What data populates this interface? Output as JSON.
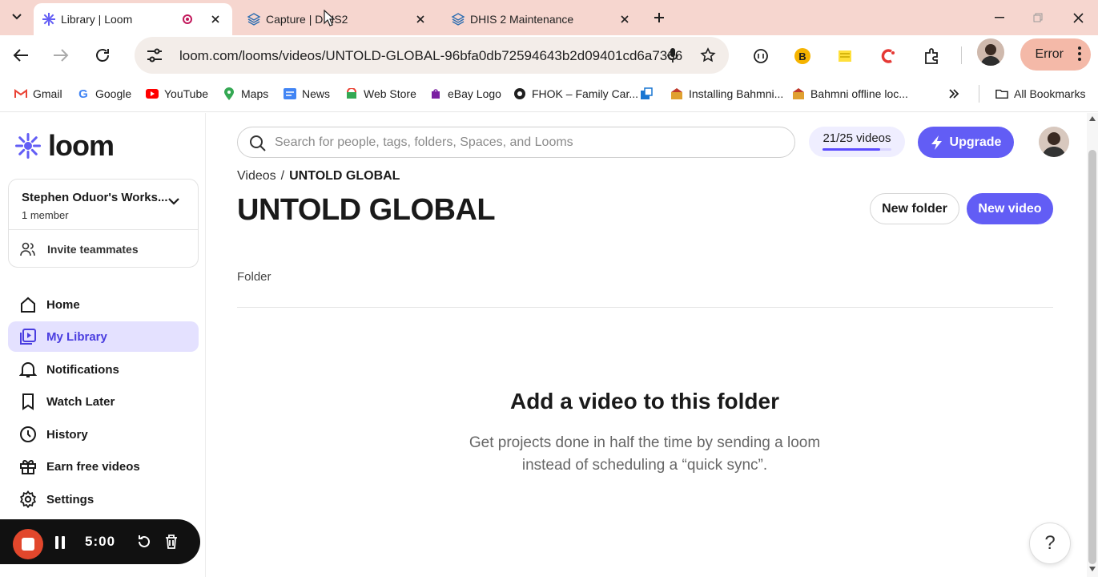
{
  "browser": {
    "tabs": [
      {
        "title": "Library | Loom",
        "active": true,
        "recording": true
      },
      {
        "title": "Capture | DHIS2",
        "active": false
      },
      {
        "title": "DHIS 2 Maintenance",
        "active": false
      }
    ],
    "url": "loom.com/looms/videos/UNTOLD-GLOBAL-96bfa0db72594643b2d09401cd6a7366",
    "error_label": "Error",
    "extension_badge": "B",
    "bookmarks": [
      {
        "label": "Gmail",
        "icon": "gmail-icon"
      },
      {
        "label": "Google",
        "icon": "google-icon"
      },
      {
        "label": "YouTube",
        "icon": "youtube-icon"
      },
      {
        "label": "Maps",
        "icon": "maps-icon"
      },
      {
        "label": "News",
        "icon": "news-icon"
      },
      {
        "label": "Web Store",
        "icon": "webstore-icon"
      },
      {
        "label": "eBay Logo",
        "icon": "ebay-icon"
      },
      {
        "label": "FHOK – Family Car...",
        "icon": "github-icon"
      },
      {
        "label": "",
        "icon": "app-icon"
      },
      {
        "label": "Installing Bahmni...",
        "icon": "bahmni-icon"
      },
      {
        "label": "Bahmni offline loc...",
        "icon": "bahmni-icon"
      }
    ],
    "all_bookmarks": "All Bookmarks"
  },
  "sidebar": {
    "logo": "loom",
    "workspace": {
      "name": "Stephen Oduor's Works...",
      "members": "1 member",
      "invite": "Invite teammates"
    },
    "nav": [
      {
        "label": "Home",
        "icon": "home-icon",
        "active": false
      },
      {
        "label": "My Library",
        "icon": "library-icon",
        "active": true
      },
      {
        "label": "Notifications",
        "icon": "bell-icon",
        "active": false
      },
      {
        "label": "Watch Later",
        "icon": "bookmark-icon",
        "active": false
      },
      {
        "label": "History",
        "icon": "clock-icon",
        "active": false
      },
      {
        "label": "Earn free videos",
        "icon": "gift-icon",
        "active": false
      },
      {
        "label": "Settings",
        "icon": "gear-icon",
        "active": false
      }
    ],
    "recorder": {
      "timer": "5:00"
    }
  },
  "main": {
    "search_placeholder": "Search for people, tags, folders, Spaces, and Looms",
    "quota": {
      "label": "21/25 videos",
      "used": 21,
      "total": 25
    },
    "upgrade": "Upgrade",
    "breadcrumb": {
      "parent": "Videos",
      "separator": "/",
      "current": "UNTOLD GLOBAL"
    },
    "title": "UNTOLD GLOBAL",
    "new_folder": "New folder",
    "new_video": "New video",
    "section_label": "Folder",
    "empty": {
      "title": "Add a video to this folder",
      "desc_line1": "Get projects done in half the time by sending a loom",
      "desc_line2": "instead of scheduling a “quick sync”."
    },
    "help": "?"
  },
  "colors": {
    "accent": "#625df5",
    "tabstrip": "#f6d6cf",
    "active_nav_bg": "#e4e1ff",
    "record_red": "#e2472c"
  }
}
